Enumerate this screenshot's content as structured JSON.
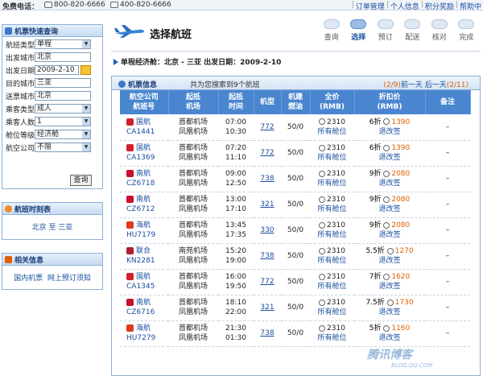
{
  "topbar": {
    "hotline_label": "免费电话：",
    "phones": [
      "800-820-6666",
      "400-820-6666"
    ],
    "links": [
      "订单管理",
      "个人信息",
      "积分奖励",
      "帮助中"
    ]
  },
  "quick_search": {
    "title": "机票快速查询",
    "fields": [
      {
        "label": "航班类型",
        "value": "单程",
        "type": "select"
      },
      {
        "label": "出发城市",
        "value": "北京",
        "type": "text"
      },
      {
        "label": "出发日期",
        "value": "2009-2-10",
        "type": "date"
      },
      {
        "label": "目的城市",
        "value": "三亚",
        "type": "text"
      },
      {
        "label": "送票城市",
        "value": "北京",
        "type": "text"
      },
      {
        "label": "乘客类型",
        "value": "成人",
        "type": "select"
      },
      {
        "label": "乘客人数",
        "value": "1",
        "type": "select"
      },
      {
        "label": "舱位等级",
        "value": "经济舱",
        "type": "select"
      },
      {
        "label": "航空公司",
        "value": "不限",
        "type": "select"
      }
    ],
    "query_button": "查询"
  },
  "timetable": {
    "title": "航班时刻表",
    "link": "北京 至 三亚"
  },
  "related": {
    "title": "相关信息",
    "links": [
      "国内机票",
      "网上预订须知"
    ]
  },
  "page": {
    "title": "选择航班",
    "steps": [
      "查询",
      "选择",
      "预订",
      "配送",
      "核对",
      "完成"
    ],
    "active_step": 1,
    "trip_line": "单程经济舱：北京 - 三亚  出发日期：2009-2-10"
  },
  "flights_panel": {
    "title": "机票信息",
    "count_text": "共为您搜索到9个航班",
    "pager_prefix": "(2/9)",
    "prev_day": "前一天",
    "next_day": "后一天",
    "pager_suffix": "(2/11)",
    "headers": [
      "航空公司\n航班号",
      "起抵\n机场",
      "起抵\n时间",
      "机型",
      "机建\n燃油",
      "全价\n(RMB)",
      "折扣价\n(RMB)",
      "备注"
    ],
    "rows": [
      {
        "airline": "国航",
        "flight": "CA1441",
        "dep_airport": "首都机场",
        "arr_airport": "凤凰机场",
        "dep_time": "07:00",
        "arr_time": "10:30",
        "model": "772",
        "tax": "50/0",
        "full_price": "2310",
        "cabins": "所有舱位",
        "discount": "6折",
        "disc_price": "1390",
        "rule": "退改签",
        "note": "–",
        "color": "#d4202a"
      },
      {
        "airline": "国航",
        "flight": "CA1369",
        "dep_airport": "首都机场",
        "arr_airport": "凤凰机场",
        "dep_time": "07:20",
        "arr_time": "11:10",
        "model": "772",
        "tax": "50/0",
        "full_price": "2310",
        "cabins": "所有舱位",
        "discount": "6折",
        "disc_price": "1390",
        "rule": "退改签",
        "note": "–",
        "color": "#d4202a"
      },
      {
        "airline": "南航",
        "flight": "CZ6718",
        "dep_airport": "首都机场",
        "arr_airport": "凤凰机场",
        "dep_time": "09:00",
        "arr_time": "12:50",
        "model": "738",
        "tax": "50/0",
        "full_price": "2310",
        "cabins": "所有舱位",
        "discount": "9折",
        "disc_price": "2080",
        "rule": "退改签",
        "note": "–",
        "color": "#c8102e"
      },
      {
        "airline": "南航",
        "flight": "CZ6712",
        "dep_airport": "首都机场",
        "arr_airport": "凤凰机场",
        "dep_time": "13:00",
        "arr_time": "17:10",
        "model": "321",
        "tax": "50/0",
        "full_price": "2310",
        "cabins": "所有舱位",
        "discount": "9折",
        "disc_price": "2080",
        "rule": "退改签",
        "note": "–",
        "color": "#c8102e"
      },
      {
        "airline": "海航",
        "flight": "HU7179",
        "dep_airport": "首都机场",
        "arr_airport": "凤凰机场",
        "dep_time": "13:45",
        "arr_time": "17:35",
        "model": "330",
        "tax": "50/0",
        "full_price": "2310",
        "cabins": "所有舱位",
        "discount": "9折",
        "disc_price": "2080",
        "rule": "退改签",
        "note": "–",
        "color": "#e03a1e"
      },
      {
        "airline": "联合",
        "flight": "KN2281",
        "dep_airport": "南苑机场",
        "arr_airport": "凤凰机场",
        "dep_time": "15:20",
        "arr_time": "19:00",
        "model": "738",
        "tax": "50/0",
        "full_price": "2310",
        "cabins": "所有舱位",
        "discount": "5.5折",
        "disc_price": "1270",
        "rule": "退改签",
        "note": "–",
        "color": "#b01c2e"
      },
      {
        "airline": "国航",
        "flight": "CA1345",
        "dep_airport": "首都机场",
        "arr_airport": "凤凰机场",
        "dep_time": "16:00",
        "arr_time": "19:50",
        "model": "772",
        "tax": "50/0",
        "full_price": "2310",
        "cabins": "所有舱位",
        "discount": "7折",
        "disc_price": "1620",
        "rule": "退改签",
        "note": "–",
        "color": "#d4202a"
      },
      {
        "airline": "南航",
        "flight": "CZ6716",
        "dep_airport": "首都机场",
        "arr_airport": "凤凰机场",
        "dep_time": "18:10",
        "arr_time": "22:00",
        "model": "321",
        "tax": "50/0",
        "full_price": "2310",
        "cabins": "所有舱位",
        "discount": "7.5折",
        "disc_price": "1730",
        "rule": "退改签",
        "note": "–",
        "color": "#c8102e"
      },
      {
        "airline": "海航",
        "flight": "HU7279",
        "dep_airport": "首都机场",
        "arr_airport": "凤凰机场",
        "dep_time": "21:30",
        "arr_time": "01:30",
        "model": "738",
        "tax": "50/0",
        "full_price": "2310",
        "cabins": "所有舱位",
        "discount": "5折",
        "disc_price": "1160",
        "rule": "退改签",
        "note": "–",
        "color": "#e03a1e"
      }
    ]
  },
  "watermark": {
    "text": "腾讯博客",
    "sub": "BLOG.QQ.COM"
  },
  "colors": {
    "accent": "#4a86d0",
    "link": "#1a4fa0",
    "price": "#e06000",
    "border": "#8cb0d8"
  }
}
